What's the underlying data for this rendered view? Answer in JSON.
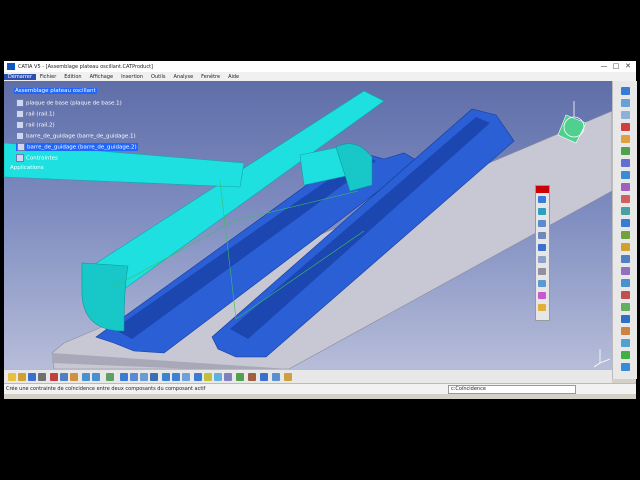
{
  "window": {
    "title": "CATIA V5 - [Assemblage plateau oscillant.CATProduct]",
    "controls": [
      "—",
      "□",
      "✕"
    ]
  },
  "menu": [
    "Démarrer",
    "Fichier",
    "Edition",
    "Affichage",
    "Insertion",
    "Outils",
    "Analyse",
    "Fenêtre",
    "Aide"
  ],
  "tree": {
    "root": "Assemblage plateau oscillant",
    "items": [
      "plaque de base (plaque de base.1)",
      "rail (rail.1)",
      "rail (rail.2)",
      "barre_de_guidage (barre_de_guidage.1)",
      "barre_de_guidage (barre_de_guidage.2)",
      "Contraintes",
      "Applications"
    ]
  },
  "status": {
    "message": "Crée une contrainte de coïncidence entre deux composants du composant actif",
    "command": "c:Coïncidence"
  },
  "colors": {
    "viewport_top": "#5f6ea8",
    "viewport_bottom": "#b7bdd9",
    "rail": "#2a5fd6",
    "bar": "#1fe0e0",
    "plate": "#c8c8d4",
    "selection": "#1f66ff"
  }
}
